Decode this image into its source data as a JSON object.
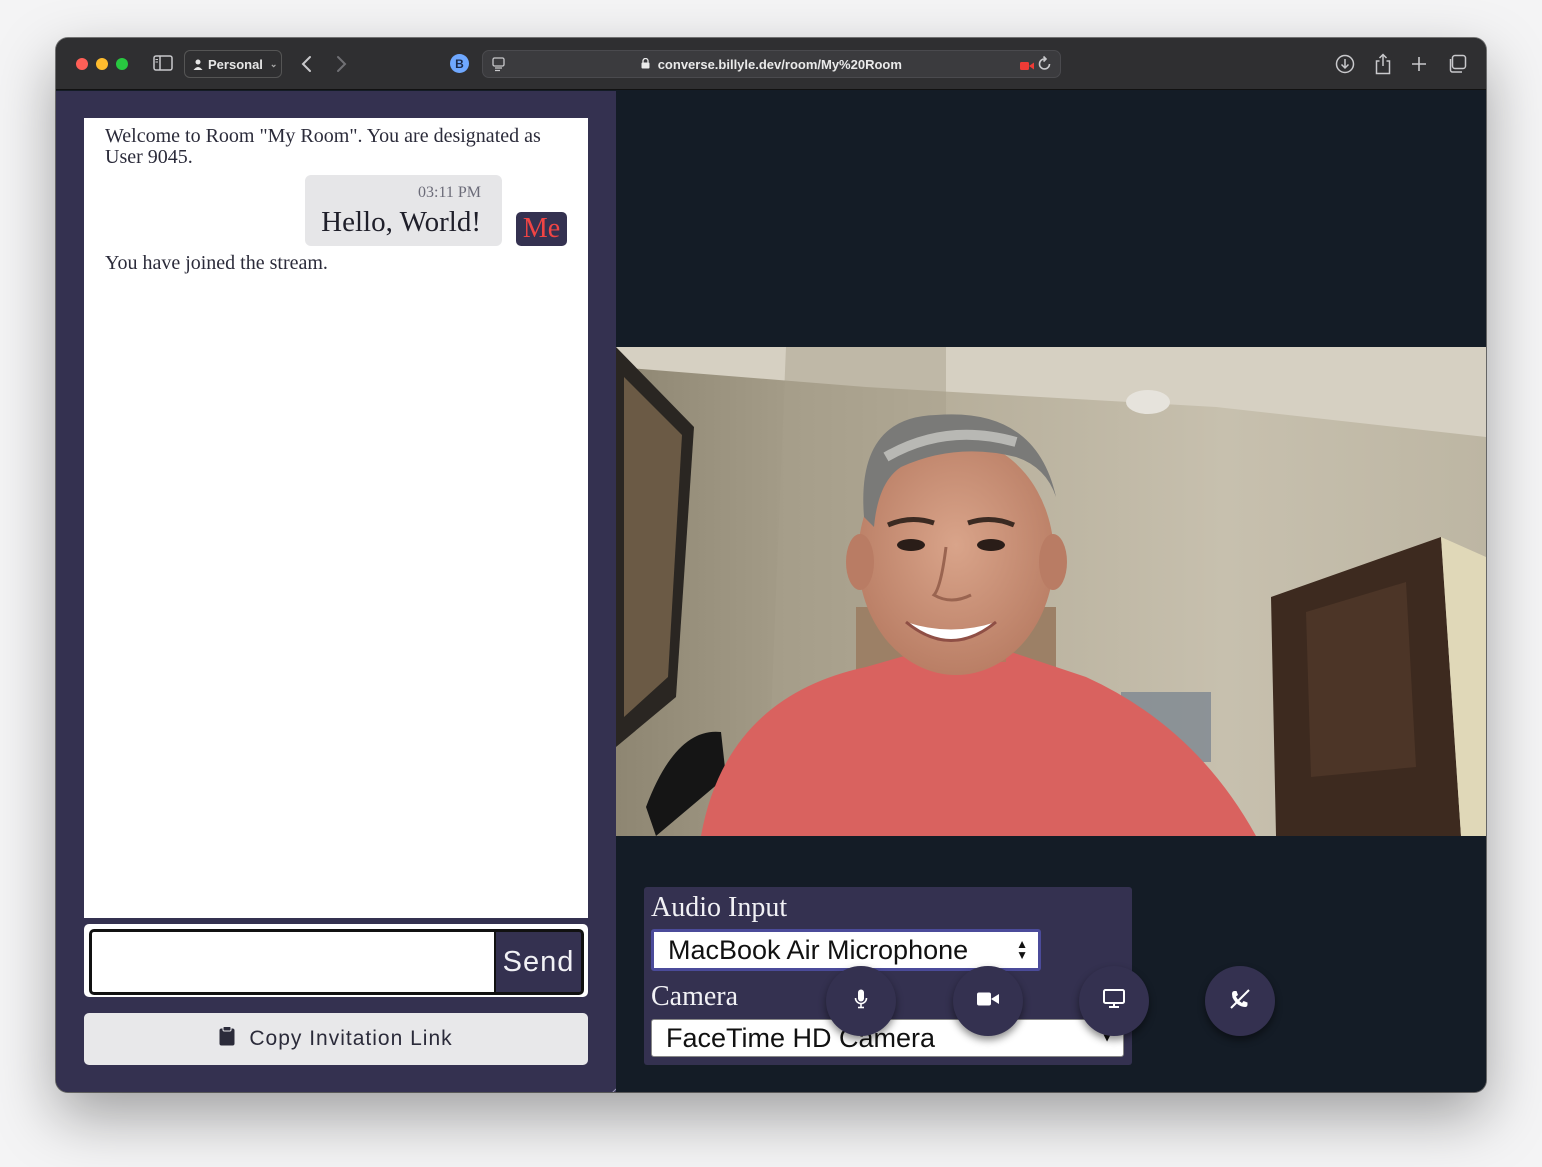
{
  "browser": {
    "profile_label": "Personal",
    "extension_letter": "B",
    "url": "converse.billyle.dev/room/My%20Room"
  },
  "chat": {
    "welcome_message": "Welcome to Room \"My Room\". You are designated as User 9045.",
    "messages": [
      {
        "time": "03:11 PM",
        "text": "Hello, World!",
        "sender_badge": "Me"
      }
    ],
    "joined_message": "You have joined the stream.",
    "input_value": "",
    "send_label": "Send",
    "copy_link_label": "Copy Invitation Link"
  },
  "devices": {
    "audio_label": "Audio Input",
    "audio_selected": "MacBook Air Microphone",
    "camera_label": "Camera",
    "camera_selected": "FaceTime HD Camera"
  },
  "controls": [
    "microphone-icon",
    "video-camera-icon",
    "monitor-icon",
    "hangup-icon"
  ],
  "colors": {
    "panel": "#343150",
    "stage_bg": "#141c26",
    "me_badge_text": "#ef4444",
    "recording_indicator": "#ef3b36"
  }
}
